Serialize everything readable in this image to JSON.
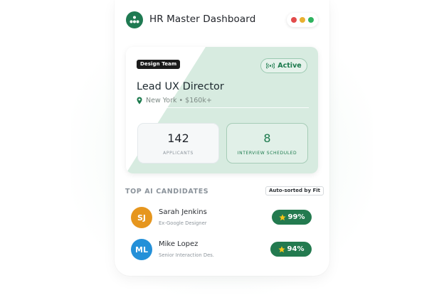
{
  "app": {
    "title": "HR Master Dashboard"
  },
  "colors": {
    "accent": "#1f7a52",
    "mac_red": "#e24b4b",
    "mac_yellow": "#e8b030",
    "mac_green": "#2fb35f"
  },
  "job": {
    "team_tag": "Design Team",
    "status": "Active",
    "title": "Lead UX Director",
    "location": "New York • $160k+",
    "stats": {
      "applicants": {
        "value": "142",
        "label": "APPLICANTS"
      },
      "interviews": {
        "value": "8",
        "label": "INTERVIEW SCHEDULED"
      }
    }
  },
  "candidates": {
    "title": "TOP AI CANDIDATES",
    "sort_label": "Auto-sorted by Fit",
    "items": [
      {
        "initials": "SJ",
        "name": "Sarah Jenkins",
        "subtitle": "Ex-Google Designer",
        "score": "99%",
        "avatar_color": "#e6961e"
      },
      {
        "initials": "ML",
        "name": "Mike Lopez",
        "subtitle": "Senior Interaction Des.",
        "score": "94%",
        "avatar_color": "#2490d8"
      }
    ]
  }
}
